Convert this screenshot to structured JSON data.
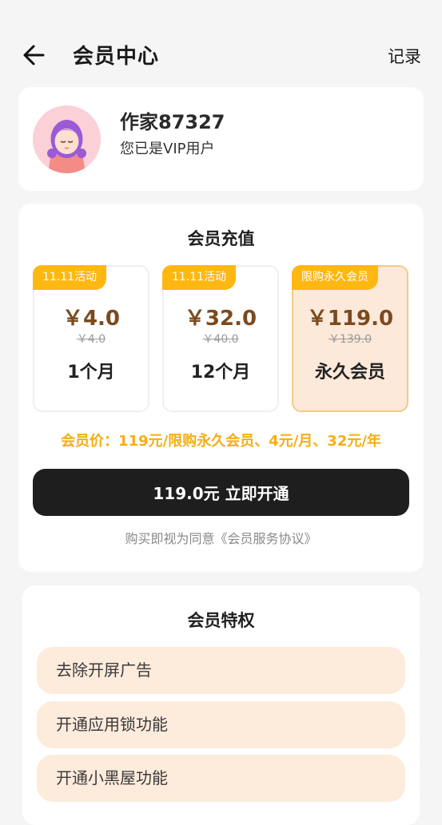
{
  "header": {
    "title": "会员中心",
    "record_label": "记录"
  },
  "profile": {
    "username": "作家87327",
    "status": "您已是VIP用户"
  },
  "recharge": {
    "title": "会员充值",
    "plans": [
      {
        "tag": "11.11活动",
        "price": "￥4.0",
        "original": "￥4.0",
        "duration": "1个月",
        "selected": false
      },
      {
        "tag": "11.11活动",
        "price": "￥32.0",
        "original": "￥40.0",
        "duration": "12个月",
        "selected": false
      },
      {
        "tag": "限购永久会员",
        "price": "￥119.0",
        "original": "￥139.0",
        "duration": "永久会员",
        "selected": true
      }
    ],
    "promo_text": "会员价：119元/限购永久会员、4元/月、32元/年",
    "buy_button": "119.0元 立即开通",
    "agreement": "购买即视为同意《会员服务协议》"
  },
  "privileges": {
    "title": "会员特权",
    "items": [
      "去除开屏广告",
      "开通应用锁功能",
      "开通小黑屋功能"
    ]
  },
  "colors": {
    "accent": "#ffb712",
    "promo_text": "#f5ae10",
    "price_text": "#7b4a1e",
    "selected_bg": "#fde9d9",
    "button_bg": "#1e1e1e",
    "privilege_bg": "#fdebdc"
  },
  "icons": {
    "back": "arrow-left-icon",
    "avatar": "avatar-illustration"
  }
}
